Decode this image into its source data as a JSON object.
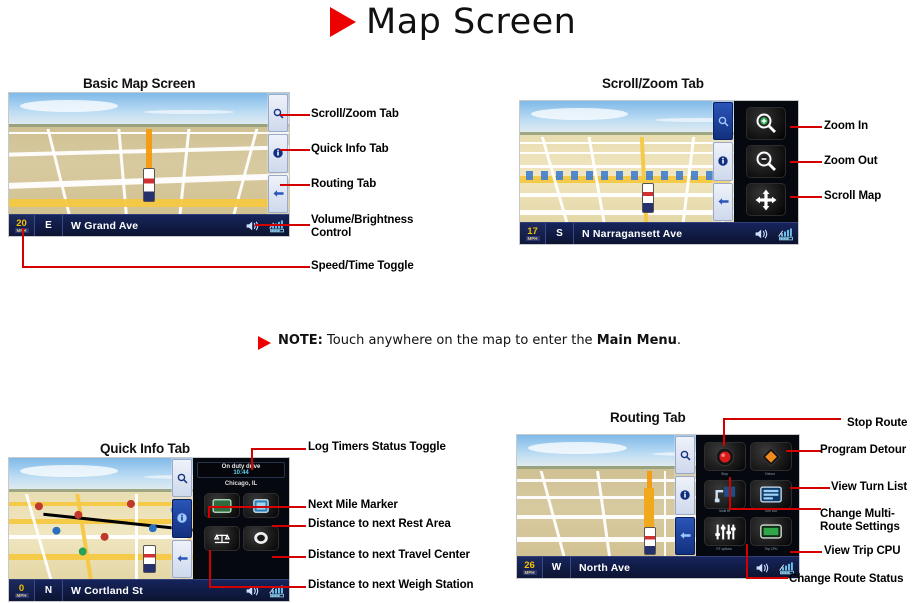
{
  "page": {
    "title": "Map Screen",
    "title_marker": "red-triangle"
  },
  "note": {
    "marker": "red-triangle",
    "label": "NOTE:",
    "text_before": " Touch anywhere on the map to enter the ",
    "bold_text": "Main Menu",
    "text_after": "."
  },
  "colors": {
    "accent_red": "#d40000",
    "marker_red": "#ec0000",
    "statusbar_blue": "#16245c",
    "speed_yellow": "#f2c200",
    "tab_active_blue": "#12307f"
  },
  "sections": [
    {
      "id": "basic-map-screen",
      "heading": "Basic Map Screen",
      "device": {
        "speed_value": "20",
        "speed_unit": "MPH",
        "heading": "E",
        "street": "W Grand Ave",
        "tabs": [
          "scroll-zoom-tab",
          "quick-info-tab",
          "routing-tab"
        ],
        "status_icons": [
          "volume-icon",
          "signal-battery-icon"
        ]
      },
      "callouts": [
        {
          "label": "Scroll/Zoom Tab"
        },
        {
          "label": "Quick Info Tab"
        },
        {
          "label": "Routing Tab"
        },
        {
          "label": "Volume/Brightness\nControl"
        },
        {
          "label": "Speed/Time Toggle"
        }
      ]
    },
    {
      "id": "scroll-zoom-tab",
      "heading": "Scroll/Zoom Tab",
      "device": {
        "speed_value": "17",
        "speed_unit": "MPH",
        "heading": "S",
        "street": "N Narragansett Ave",
        "panel_buttons": [
          "zoom-in-icon",
          "zoom-out-icon",
          "scroll-map-icon"
        ],
        "status_icons": [
          "volume-icon",
          "signal-battery-icon"
        ]
      },
      "callouts": [
        {
          "label": "Zoom In"
        },
        {
          "label": "Zoom Out"
        },
        {
          "label": "Scroll Map"
        }
      ]
    },
    {
      "id": "quick-info-tab",
      "heading": "Quick Info Tab",
      "device": {
        "speed_value": "0",
        "speed_unit": "MPH",
        "heading": "N",
        "street": "W Cortland St",
        "info_header_line1": "On duty drive",
        "info_header_line2": "10:44",
        "info_city": "Chicago,\nIL",
        "panel_buttons": [
          {
            "icon": "mile-marker-icon",
            "caption": ""
          },
          {
            "icon": "rest-area-icon",
            "caption": ""
          },
          {
            "icon": "weigh-station-icon",
            "caption": ""
          },
          {
            "icon": "travel-center-icon",
            "caption": ""
          }
        ],
        "status_icons": [
          "volume-icon",
          "signal-battery-icon"
        ]
      },
      "callouts": [
        {
          "label": "Log Timers Status Toggle"
        },
        {
          "label": "Next Mile Marker"
        },
        {
          "label": "Distance to next Rest Area"
        },
        {
          "label": "Distance to next Travel Center"
        },
        {
          "label": "Distance to next Weigh Station"
        }
      ]
    },
    {
      "id": "routing-tab",
      "heading": "Routing Tab",
      "device": {
        "speed_value": "26",
        "speed_unit": "MPH",
        "heading": "W",
        "street": "North Ave",
        "panel_buttons": [
          {
            "icon": "stop-route-icon",
            "caption": "Stop"
          },
          {
            "icon": "detour-icon",
            "caption": "Detour"
          },
          {
            "icon": "multi-route-icon",
            "caption": "Multi Rt"
          },
          {
            "icon": "turn-list-icon",
            "caption": "Turn List"
          },
          {
            "icon": "rt-options-icon",
            "caption": "RT options"
          },
          {
            "icon": "trip-cpu-icon",
            "caption": "Trip CPU"
          }
        ],
        "status_icons": [
          "volume-icon",
          "signal-battery-icon"
        ]
      },
      "callouts": [
        {
          "label": "Stop Route"
        },
        {
          "label": "Program Detour"
        },
        {
          "label": "View Turn List"
        },
        {
          "label": "Change Multi-\nRoute Settings"
        },
        {
          "label": "View Trip CPU"
        },
        {
          "label": "Change Route Status"
        }
      ]
    }
  ]
}
